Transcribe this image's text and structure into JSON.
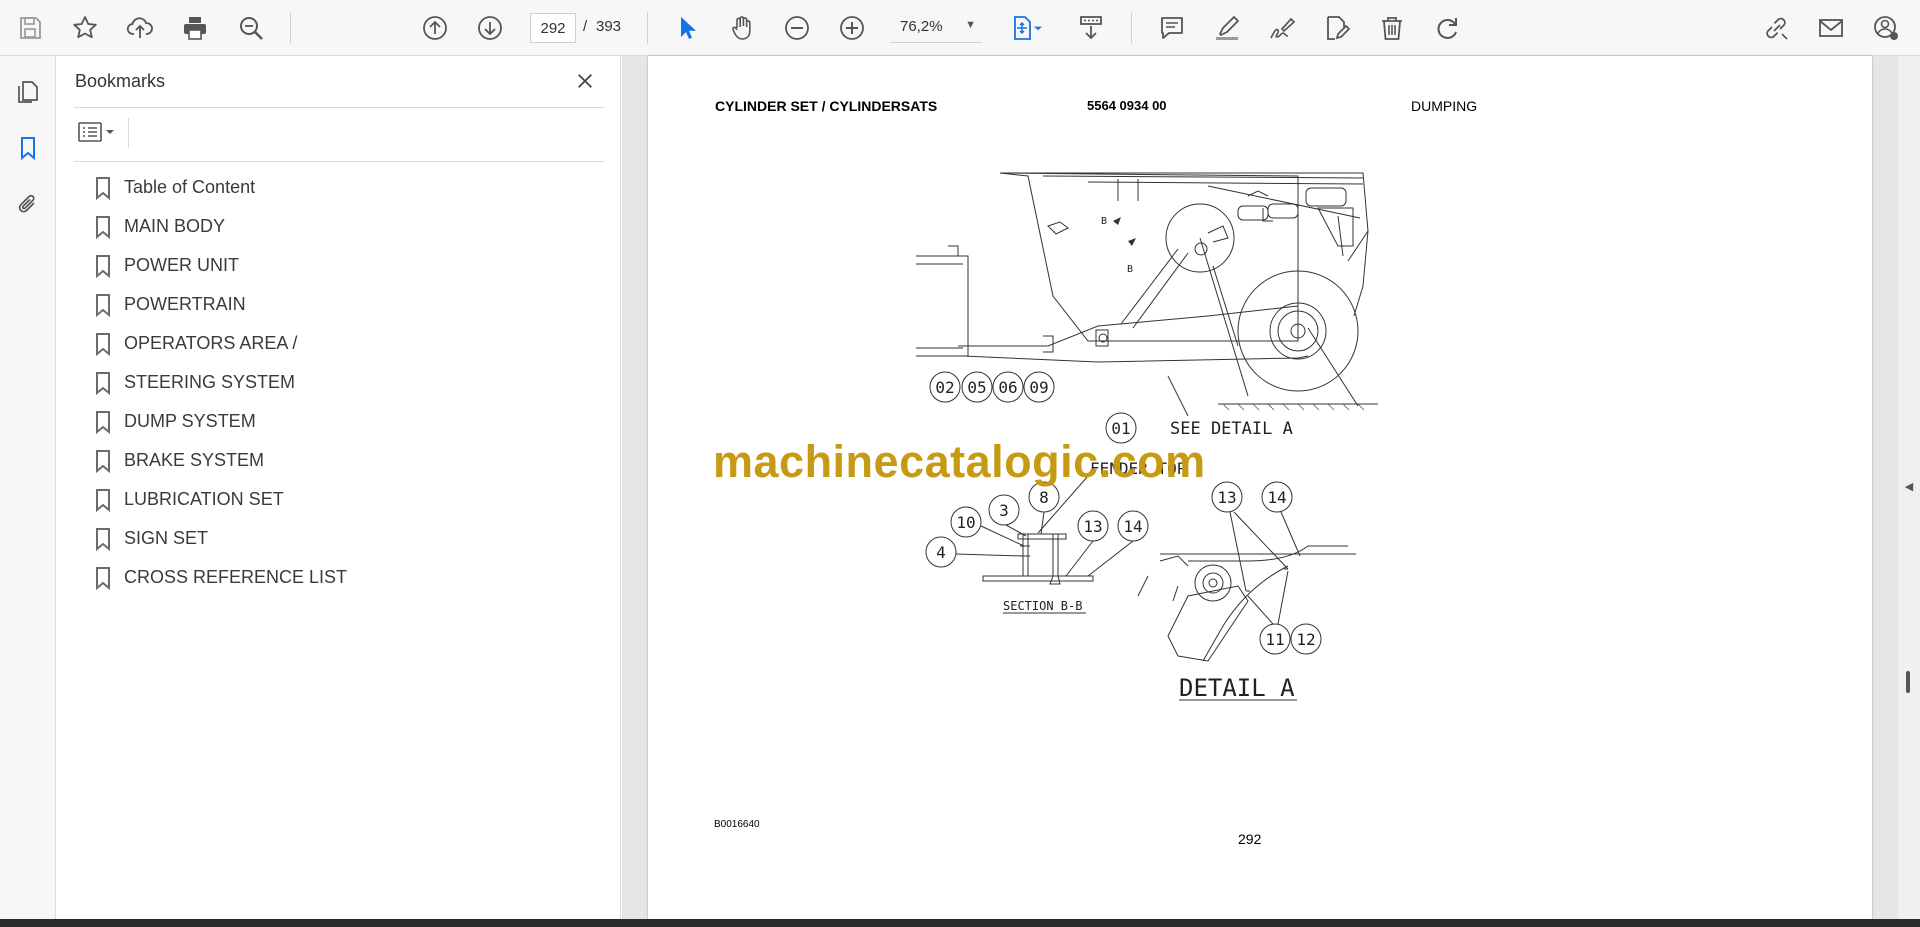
{
  "toolbar": {
    "buttons": [
      {
        "name": "save-icon"
      },
      {
        "name": "star-icon"
      },
      {
        "name": "cloud-upload-icon"
      },
      {
        "name": "print-icon"
      },
      {
        "name": "find-zoom-icon"
      },
      {
        "name": "prev-page-icon"
      },
      {
        "name": "next-page-icon"
      },
      {
        "name": "select-cursor-icon"
      },
      {
        "name": "hand-icon"
      },
      {
        "name": "zoom-out-icon"
      },
      {
        "name": "zoom-in-icon"
      },
      {
        "name": "fit-page-icon"
      },
      {
        "name": "scroll-mode-icon"
      },
      {
        "name": "comment-icon"
      },
      {
        "name": "highlight-icon"
      },
      {
        "name": "sign-icon"
      },
      {
        "name": "edit-text-icon"
      },
      {
        "name": "delete-icon"
      },
      {
        "name": "rotate-icon"
      },
      {
        "name": "share-link-icon"
      },
      {
        "name": "email-icon"
      },
      {
        "name": "account-icon"
      }
    ],
    "page_current": "292",
    "page_separator": "/",
    "page_total": "393",
    "zoom": "76,2%",
    "accent_color": "#1473e6"
  },
  "left_rail": {
    "items": [
      {
        "name": "page-thumbnails-icon",
        "active": false
      },
      {
        "name": "bookmark-icon",
        "active": true
      },
      {
        "name": "attachment-icon",
        "active": false
      }
    ]
  },
  "bookmarks": {
    "title": "Bookmarks",
    "items": [
      {
        "label": "Table of Content"
      },
      {
        "label": "MAIN BODY"
      },
      {
        "label": "POWER UNIT"
      },
      {
        "label": "POWERTRAIN"
      },
      {
        "label": "OPERATORS AREA /"
      },
      {
        "label": "STEERING SYSTEM"
      },
      {
        "label": "DUMP SYSTEM"
      },
      {
        "label": "BRAKE SYSTEM"
      },
      {
        "label": "LUBRICATION SET"
      },
      {
        "label": "SIGN SET"
      },
      {
        "label": "CROSS REFERENCE LIST"
      }
    ]
  },
  "document": {
    "header_title": "CYLINDER SET / CYLINDERSATS",
    "header_part_no": "5564 0934 00",
    "header_section": "DUMPING",
    "drawing_id": "B0016640",
    "page_number": "292",
    "watermark": "machinecatalogic.com",
    "callouts_top": [
      "02",
      "05",
      "06",
      "09"
    ],
    "callout_main": "01",
    "see_detail_label": "SEE DETAIL A",
    "fender_top_label": "FENDER TOP",
    "section_callouts": [
      "3",
      "8",
      "10",
      "4",
      "13",
      "14"
    ],
    "section_label": "SECTION B-B",
    "detail_callouts_top": [
      "13",
      "14"
    ],
    "detail_callouts_bottom": [
      "11",
      "12"
    ],
    "detail_label": "DETAIL A",
    "section_marker": "B",
    "watermark_color": "#c69a12"
  }
}
